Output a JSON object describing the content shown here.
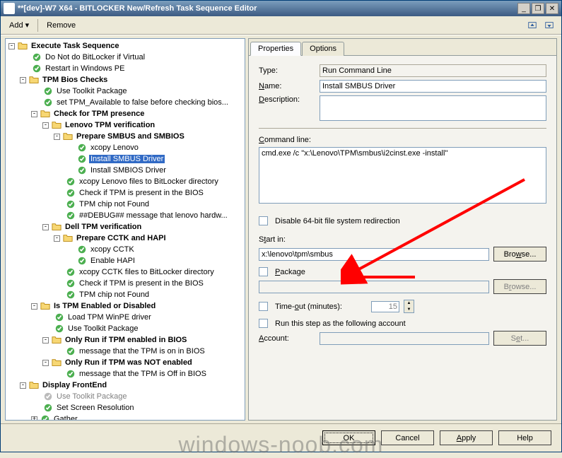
{
  "window": {
    "title": "**[dev]-W7 X64 - BITLOCKER New/Refresh Task Sequence Editor"
  },
  "toolbar": {
    "add": "Add",
    "remove": "Remove"
  },
  "tree": [
    {
      "d": 0,
      "t": "f",
      "b": 1,
      "exp": "-",
      "txt": "Execute Task Sequence"
    },
    {
      "d": 1,
      "t": "s",
      "txt": "Do Not do BitLocker if Virtual"
    },
    {
      "d": 1,
      "t": "s",
      "txt": "Restart in Windows PE"
    },
    {
      "d": 1,
      "t": "f",
      "b": 1,
      "exp": "-",
      "txt": "TPM Bios Checks"
    },
    {
      "d": 2,
      "t": "s",
      "txt": "Use Toolkit Package"
    },
    {
      "d": 2,
      "t": "s",
      "txt": "set TPM_Available to false before checking bios..."
    },
    {
      "d": 2,
      "t": "f",
      "b": 1,
      "exp": "-",
      "txt": "Check for TPM presence"
    },
    {
      "d": 3,
      "t": "f",
      "b": 1,
      "exp": "-",
      "txt": "Lenovo TPM verification"
    },
    {
      "d": 4,
      "t": "f",
      "b": 1,
      "exp": "-",
      "txt": "Prepare SMBUS and SMBIOS"
    },
    {
      "d": 5,
      "t": "s",
      "txt": "xcopy Lenovo"
    },
    {
      "d": 5,
      "t": "s",
      "sel": 1,
      "txt": "Install SMBUS Driver"
    },
    {
      "d": 5,
      "t": "s",
      "txt": "Install SMBIOS Driver"
    },
    {
      "d": 4,
      "t": "s",
      "txt": "xcopy Lenovo files to BitLocker directory"
    },
    {
      "d": 4,
      "t": "s",
      "txt": "Check if TPM is present in the BIOS"
    },
    {
      "d": 4,
      "t": "s",
      "txt": "TPM chip not Found"
    },
    {
      "d": 4,
      "t": "s",
      "txt": "##DEBUG## message that lenovo hardw..."
    },
    {
      "d": 3,
      "t": "f",
      "b": 1,
      "exp": "-",
      "txt": "Dell TPM verification"
    },
    {
      "d": 4,
      "t": "f",
      "b": 1,
      "exp": "-",
      "txt": "Prepare CCTK and HAPI"
    },
    {
      "d": 5,
      "t": "s",
      "txt": "xcopy CCTK"
    },
    {
      "d": 5,
      "t": "s",
      "txt": "Enable HAPI"
    },
    {
      "d": 4,
      "t": "s",
      "txt": "xcopy CCTK files to BitLocker directory"
    },
    {
      "d": 4,
      "t": "s",
      "txt": "Check if TPM is present in the BIOS"
    },
    {
      "d": 4,
      "t": "s",
      "txt": "TPM chip not Found"
    },
    {
      "d": 2,
      "t": "f",
      "b": 1,
      "exp": "-",
      "txt": "Is TPM Enabled or Disabled"
    },
    {
      "d": 3,
      "t": "s",
      "txt": "Load TPM WinPE driver"
    },
    {
      "d": 3,
      "t": "s",
      "txt": "Use Toolkit Package"
    },
    {
      "d": 3,
      "t": "f",
      "b": 1,
      "exp": "-",
      "txt": "Only Run if TPM enabled in BIOS"
    },
    {
      "d": 4,
      "t": "s",
      "txt": "message that the  TPM is on in BIOS"
    },
    {
      "d": 3,
      "t": "f",
      "b": 1,
      "exp": "-",
      "txt": "Only Run if TPM was NOT enabled"
    },
    {
      "d": 4,
      "t": "s",
      "txt": "message that the  TPM is Off in BIOS"
    },
    {
      "d": 1,
      "t": "f",
      "b": 1,
      "exp": "-",
      "txt": "Display FrontEnd"
    },
    {
      "d": 2,
      "t": "s",
      "dis": 1,
      "txt": "Use Toolkit Package"
    },
    {
      "d": 2,
      "t": "s",
      "txt": "Set Screen Resolution"
    },
    {
      "d": 2,
      "t": "s",
      "exp": "+",
      "txt": "Gather"
    }
  ],
  "tabs": {
    "properties": "Properties",
    "options": "Options"
  },
  "form": {
    "type_label": "Type:",
    "type_value": "Run Command Line",
    "name_label": "Name:",
    "name_value": "Install SMBUS Driver",
    "desc_label": "Description:",
    "desc_value": "",
    "cmd_label": "Command line:",
    "cmd_value": "cmd.exe /c \"x:\\Lenovo\\TPM\\smbus\\i2cinst.exe -install\"",
    "disable64_label": "Disable 64-bit file system redirection",
    "startin_label": "Start in:",
    "startin_value": "x:\\lenovo\\tpm\\smbus",
    "browse": "Browse...",
    "package_label": "Package",
    "timeout_label": "Time-out (minutes):",
    "timeout_value": "15",
    "runas_label": "Run this step as the following account",
    "account_label": "Account:",
    "set": "Set..."
  },
  "footer": {
    "ok": "OK",
    "cancel": "Cancel",
    "apply": "Apply",
    "help": "Help"
  },
  "watermark": "windows-noob.com"
}
